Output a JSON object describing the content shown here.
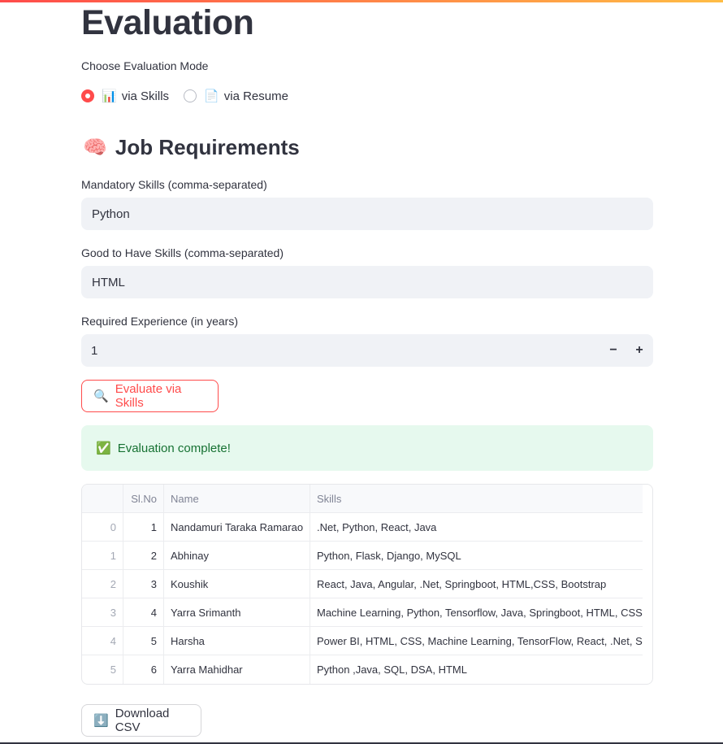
{
  "page": {
    "title": "Evaluation"
  },
  "mode": {
    "label": "Choose Evaluation Mode",
    "options": [
      {
        "emoji": "📊",
        "label": "via Skills",
        "selected": true
      },
      {
        "emoji": "📄",
        "label": "via Resume",
        "selected": false
      }
    ]
  },
  "requirements": {
    "emoji": "🧠",
    "title": "Job Requirements",
    "mandatory": {
      "label": "Mandatory Skills (comma-separated)",
      "value": "Python"
    },
    "good_to_have": {
      "label": "Good to Have Skills (comma-separated)",
      "value": "HTML"
    },
    "experience": {
      "label": "Required Experience (in years)",
      "value": "1",
      "minus": "−",
      "plus": "+"
    }
  },
  "evaluate_button": {
    "emoji": "🔍",
    "label": "Evaluate via Skills"
  },
  "alert": {
    "emoji": "✅",
    "text": "Evaluation complete!"
  },
  "table": {
    "columns": [
      "",
      "Sl.No",
      "Name",
      "Skills"
    ],
    "rows": [
      {
        "index": "0",
        "sl": "1",
        "name": "Nandamuri Taraka Ramarao",
        "skills": ".Net, Python, React, Java"
      },
      {
        "index": "1",
        "sl": "2",
        "name": "Abhinay",
        "skills": "Python, Flask, Django, MySQL"
      },
      {
        "index": "2",
        "sl": "3",
        "name": "Koushik",
        "skills": "React, Java, Angular, .Net, Springboot, HTML,CSS, Bootstrap"
      },
      {
        "index": "3",
        "sl": "4",
        "name": "Yarra Srimanth",
        "skills": "Machine Learning, Python, Tensorflow, Java, Springboot, HTML, CSS,"
      },
      {
        "index": "4",
        "sl": "5",
        "name": "Harsha",
        "skills": "Power BI, HTML, CSS, Machine Learning, TensorFlow, React, .Net, Spri"
      },
      {
        "index": "5",
        "sl": "6",
        "name": "Yarra Mahidhar",
        "skills": "Python ,Java, SQL, DSA, HTML"
      }
    ]
  },
  "download_button": {
    "emoji": "⬇️",
    "label": "Download CSV"
  }
}
